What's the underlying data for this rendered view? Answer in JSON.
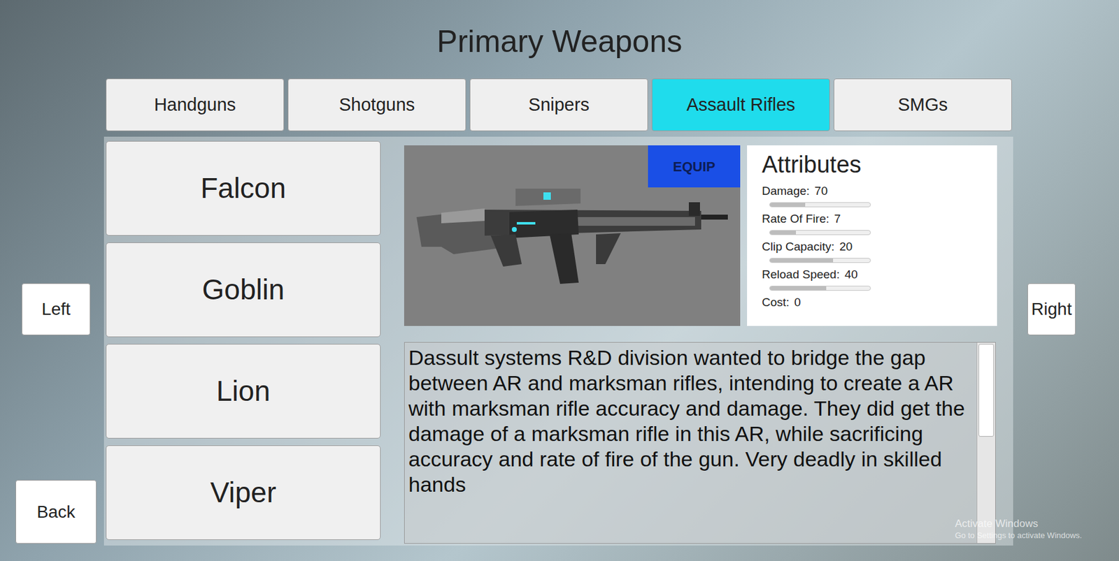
{
  "title": "Primary Weapons",
  "tabs": [
    {
      "label": "Handguns",
      "selected": false
    },
    {
      "label": "Shotguns",
      "selected": false
    },
    {
      "label": "Snipers",
      "selected": false
    },
    {
      "label": "Assault Rifles",
      "selected": true
    },
    {
      "label": "SMGs",
      "selected": false
    }
  ],
  "weapons": [
    "Falcon",
    "Goblin",
    "Lion",
    "Viper"
  ],
  "equip_button": "EQUIP",
  "attributes": {
    "title": "Attributes",
    "rows": [
      {
        "kind": "bar",
        "label": "Damage:",
        "value": "70",
        "level": 0.35
      },
      {
        "kind": "bar",
        "label": "Rate Of Fire:",
        "value": "7",
        "level": 0.26
      },
      {
        "kind": "bar",
        "label": "Clip Capacity:",
        "value": "20",
        "level": 0.63
      },
      {
        "kind": "bar",
        "label": "Reload Speed:",
        "value": "40",
        "level": 0.56
      },
      {
        "kind": "text",
        "label": "Cost:",
        "value": "0"
      }
    ]
  },
  "description": "Dassult systems R&D division wanted to bridge the gap between AR and marksman rifles, intending to create a AR with marksman rifle accuracy and damage. They did get the damage of a marksman rifle in this AR, while sacrificing accuracy and rate of fire of the gun. Very deadly in skilled hands",
  "nav": {
    "left": "Left",
    "right": "Right",
    "back": "Back"
  },
  "watermark": {
    "title": "Activate Windows",
    "subtitle": "Go to Settings to activate Windows."
  }
}
